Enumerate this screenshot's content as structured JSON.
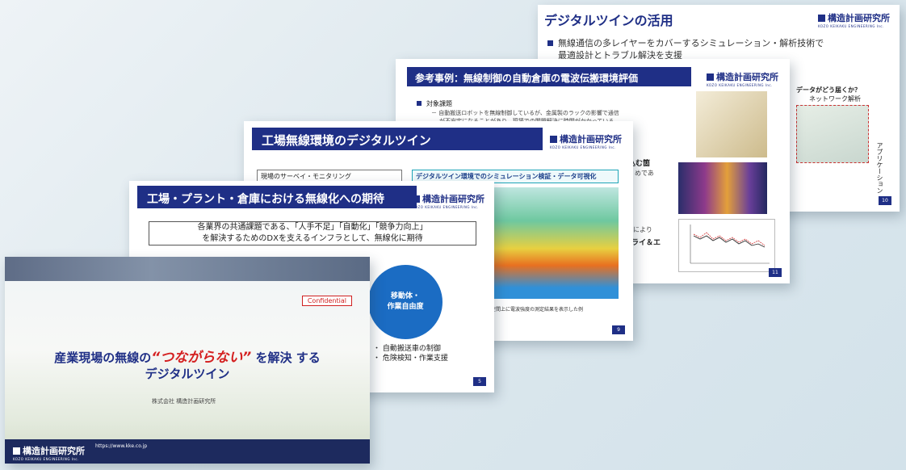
{
  "slide5": {
    "title": "デジタルツインの活用",
    "bullet": "無線通信の多レイヤーをカバーするシミュレーション・解析技術で",
    "bullet2": "最適設計とトラブル解決を支援",
    "question": "データがどう届くか？",
    "net_label": "ネットワーク解析",
    "vertical": "アプリケーション",
    "page": "10"
  },
  "slide4": {
    "title": "参考事例：無線制御の自動倉庫の電波伝搬環境評価",
    "bullet": "対象課題",
    "detail1": "－ 自動搬送ロボットを無線制御しているが、金属製のラックの影響で通信",
    "detail2": "が不安定になることがあり、現場での問題解決に時間がかかっている",
    "frag1": "込む箇",
    "frag2": "めであ",
    "frag3": "ンにより",
    "frag4": "ライ＆エ",
    "page": "11"
  },
  "slide3": {
    "title": "工場無線環境のデジタルツイン",
    "left_label": "現場のサーベイ・モニタリング",
    "right_label": "デジタルツイン環境でのシミュレーション検証・データ可視化",
    "caption": "る空間上に電波強度の測定結果を表示した例",
    "page": "9"
  },
  "slide2": {
    "title": "工場・プラント・倉庫における無線化への期待",
    "box_line1": "各業界の共通課題である、「人手不足」「自動化」「競争力向上」",
    "box_line2": "を解決するためのDXを支えるインフラとして、無線化に期待",
    "circle_line1": "移動体・",
    "circle_line2": "作業自由度",
    "item1": "・ 自動搬送車の制御",
    "item2": "・ 危険検知・作業支援",
    "page": "5"
  },
  "slide1": {
    "confidential": "Confidential",
    "title_pre": "産業現場の無線の",
    "title_red": "“つながらない”",
    "title_mid": "を解決",
    "title_post": "する",
    "subtitle": "デジタルツイン",
    "company": "株式会社 構造計画研究所",
    "url": "https://www.kke.co.jp"
  },
  "logo": {
    "name": "構造計画研究所",
    "sub": "KOZO KEIKAKU ENGINEERING Inc."
  }
}
